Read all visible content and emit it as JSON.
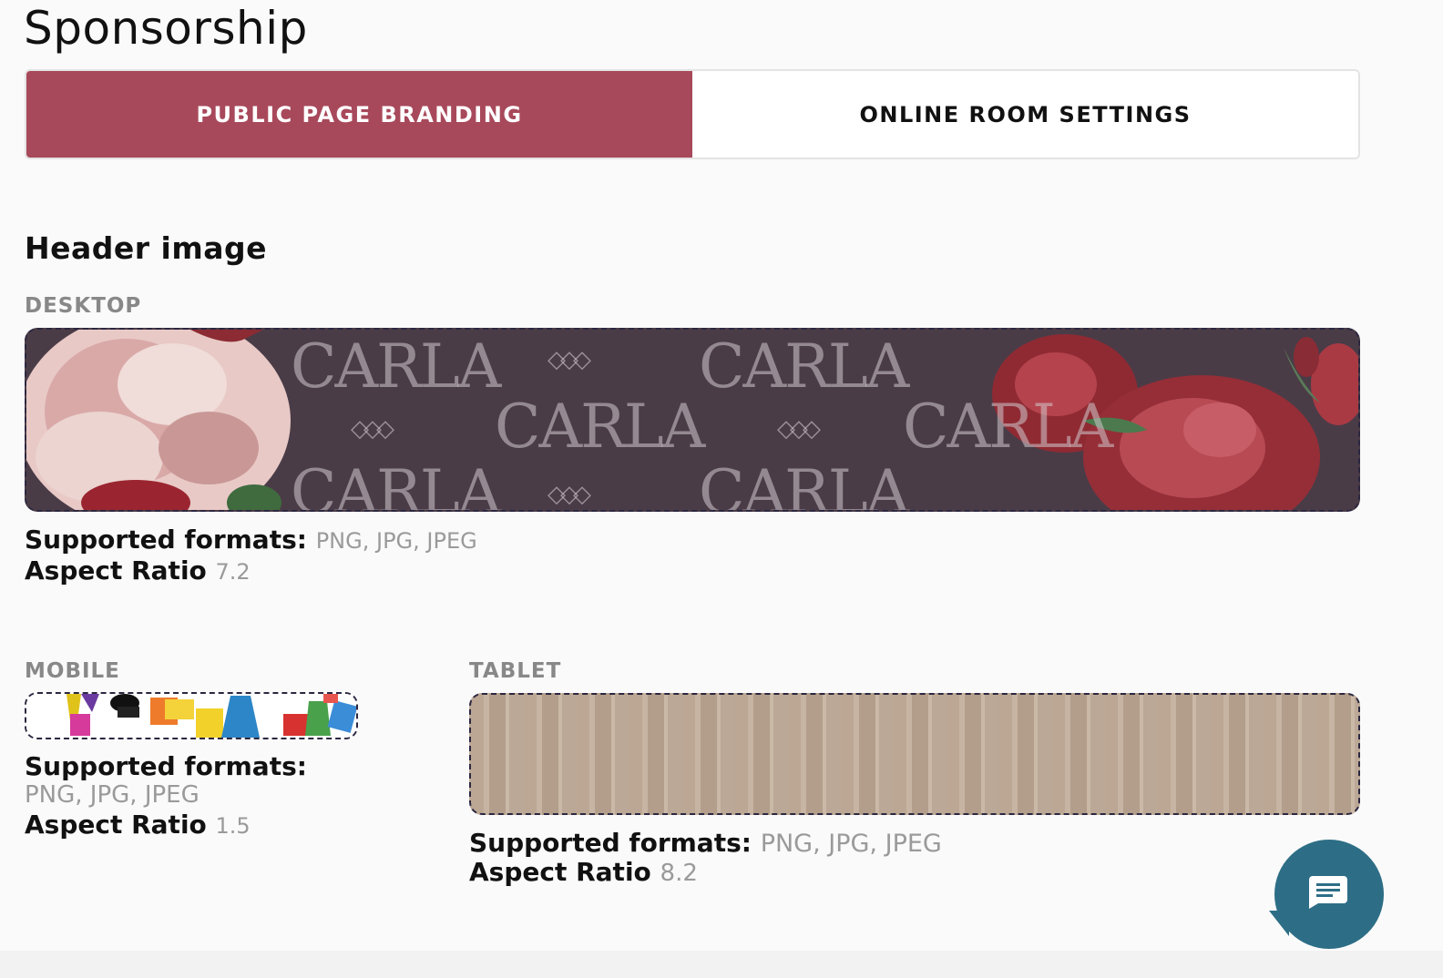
{
  "page": {
    "title": "Sponsorship"
  },
  "tabs": [
    {
      "label": "PUBLIC PAGE BRANDING",
      "active": true
    },
    {
      "label": "ONLINE ROOM SETTINGS",
      "active": false
    }
  ],
  "header_image": {
    "heading": "Header image",
    "desktop": {
      "label": "DESKTOP",
      "formats_label": "Supported formats:",
      "formats_value": "PNG, JPG, JPEG",
      "aspect_label": "Aspect Ratio",
      "aspect_value": "7.2",
      "watermark_text": "CARLA"
    },
    "mobile": {
      "label": "MOBILE",
      "formats_label": "Supported formats:",
      "formats_value": "PNG, JPG, JPEG",
      "aspect_label": "Aspect Ratio",
      "aspect_value": "1.5"
    },
    "tablet": {
      "label": "TABLET",
      "formats_label": "Supported formats:",
      "formats_value": "PNG, JPG, JPEG",
      "aspect_label": "Aspect Ratio",
      "aspect_value": "8.2"
    }
  },
  "colors": {
    "accent": "#a8495b",
    "chat": "#2d6e86",
    "banner_bg": "#4a3c47"
  },
  "icons": {
    "chat": "chat-bubble-icon"
  }
}
